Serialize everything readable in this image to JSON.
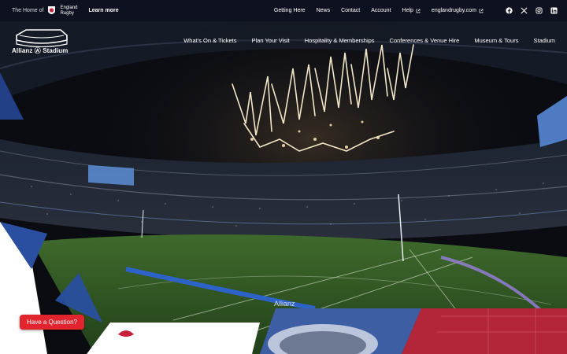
{
  "topbar": {
    "home_of": "The Home of",
    "brand_line1": "England",
    "brand_line2": "Rugby",
    "learn_more": "Learn more",
    "links": [
      "Getting Here",
      "News",
      "Contact",
      "Account",
      "Help",
      "englandrugby.com"
    ],
    "socials": [
      "facebook-icon",
      "x-icon",
      "instagram-icon",
      "linkedin-icon"
    ]
  },
  "nav": {
    "logo_text": "Allianz Ⓐ Stadium",
    "items": [
      "What's On & Tickets",
      "Plan Your Visit",
      "Hospitality & Memberships",
      "Conferences & Venue Hire",
      "Museum & Tours",
      "Stadium"
    ]
  },
  "cta": {
    "question": "Have a Question?"
  },
  "hero": {
    "ad_board_text": "Allianz"
  },
  "colors": {
    "topbar": "#0e1220",
    "accent_red": "#e1242e",
    "blue": "#2a4fa0",
    "red_block": "#b3263a"
  }
}
